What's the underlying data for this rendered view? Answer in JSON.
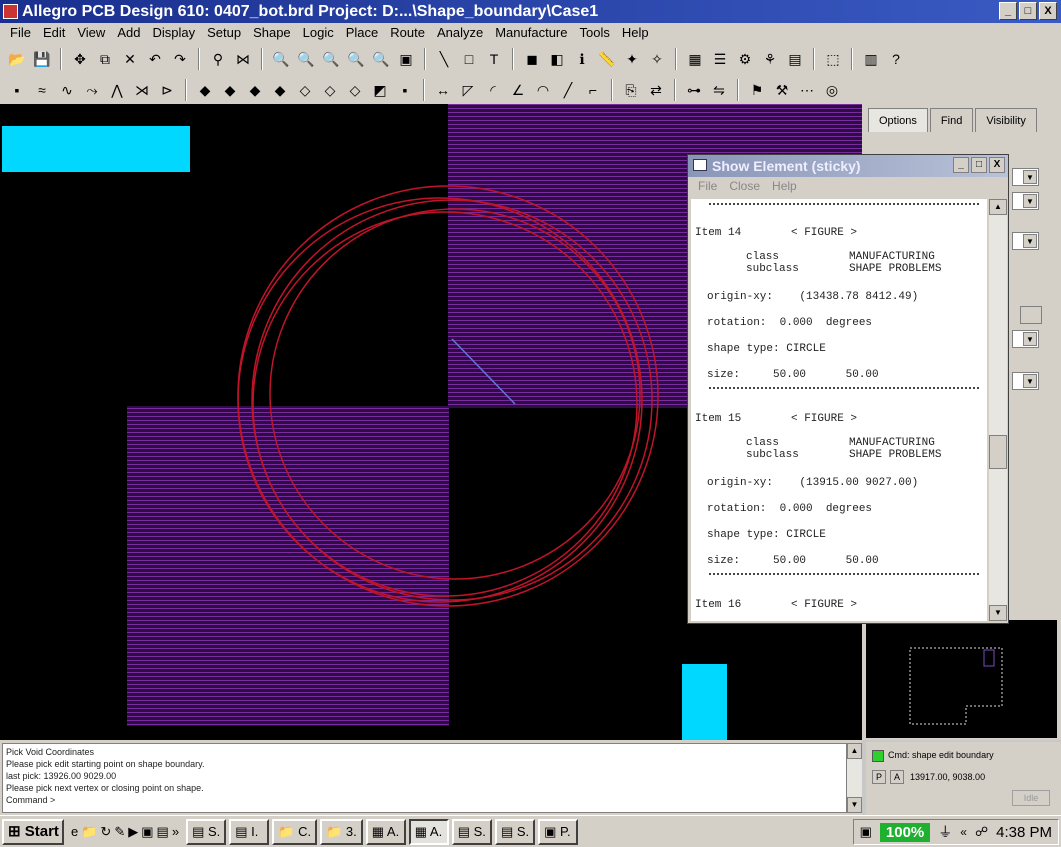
{
  "window": {
    "title": "Allegro PCB Design 610: 0407_bot.brd  Project: D:...\\Shape_boundary\\Case1",
    "controls": [
      "_",
      "□",
      "X"
    ]
  },
  "menubar": [
    "File",
    "Edit",
    "View",
    "Add",
    "Display",
    "Setup",
    "Shape",
    "Logic",
    "Place",
    "Route",
    "Analyze",
    "Manufacture",
    "Tools",
    "Help"
  ],
  "toolbar": {
    "row1": [
      "open-icon",
      "save-icon",
      "|",
      "move-icon",
      "copy-icon",
      "delete-icon",
      "undo-icon",
      "redo-icon",
      "|",
      "pin-icon",
      "ratsnest-icon",
      "|",
      "zoom-points-icon",
      "zoom-in-icon",
      "zoom-out-icon",
      "zoom-fit-icon",
      "zoom-prev-icon",
      "3d-view-icon",
      "|",
      "add-line-icon",
      "add-rect-icon",
      "add-text-icon",
      "|",
      "color-icon",
      "shadow-icon",
      "info-icon",
      "measure-icon",
      "highlight-icon",
      "dehighlight-icon",
      "|",
      "grid-icon",
      "layers-icon",
      "constraint-icon",
      "spif-icon",
      "cmgr-icon",
      "|",
      "place-icon",
      "|",
      "report-icon",
      "help-icon"
    ],
    "row2": [
      "add-connect-icon",
      "slide-icon",
      "delay-tune-icon",
      "custom-smooth-icon",
      "vertex-icon",
      "spread-icon",
      "fanout-icon",
      "|",
      "shape-add-icon",
      "shape-rect-icon",
      "shape-circle-icon",
      "shape-select-icon",
      "void-poly-icon",
      "void-rect-icon",
      "void-circle-icon",
      "edit-boundary-icon",
      "manual-void-icon",
      "|",
      "dimension-icon",
      "chamfer-icon",
      "fillet-icon",
      "angle-icon",
      "arc-icon",
      "line-icon",
      "segment-icon",
      "|",
      "sub-drawing-icon",
      "swap-icon",
      "|",
      "net-logic-icon",
      "pin-swap-icon",
      "|",
      "assign-icon",
      "tool-icon",
      "bus-icon",
      "spectra-icon"
    ]
  },
  "options_panel": {
    "tabs": [
      "Options",
      "Find",
      "Visibility"
    ]
  },
  "show_element": {
    "title": "Show Element (sticky)",
    "menu": [
      "File",
      "Close",
      "Help"
    ],
    "items": [
      {
        "header": "Item 14",
        "type": "< FIGURE >",
        "class_label": "class",
        "class_value": "MANUFACTURING",
        "subclass_label": "subclass",
        "subclass_value": "SHAPE PROBLEMS",
        "origin": "origin-xy:    (13438.78 8412.49)",
        "rotation": "rotation:  0.000  degrees",
        "shape": "shape type: CIRCLE",
        "size": "size:     50.00      50.00"
      },
      {
        "header": "Item 15",
        "type": "< FIGURE >",
        "class_label": "class",
        "class_value": "MANUFACTURING",
        "subclass_label": "subclass",
        "subclass_value": "SHAPE PROBLEMS",
        "origin": "origin-xy:    (13915.00 9027.00)",
        "rotation": "rotation:  0.000  degrees",
        "shape": "shape type: CIRCLE",
        "size": "size:     50.00      50.00"
      },
      {
        "header": "Item 16",
        "type": "< FIGURE >"
      }
    ]
  },
  "command_window": {
    "lines": [
      "Pick Void Coordinates",
      "Please pick edit starting point on shape boundary.",
      "last pick:  13926.00 9029.00",
      "Please pick next vertex or closing point on shape.",
      "Command >"
    ]
  },
  "status": {
    "cmd": "Cmd:  shape edit boundary",
    "p_label": "P",
    "a_label": "A",
    "coords": "13917.00, 9038.00",
    "idle": "Idle"
  },
  "taskbar": {
    "start": "Start",
    "quick_icons": [
      "ie-icon",
      "folder-icon",
      "refresh-icon",
      "pen-icon",
      "media-icon",
      "app-icon",
      "app2-icon",
      "chevron-icon"
    ],
    "tasks": [
      {
        "label": "S.",
        "icon": "doc-icon",
        "active": false
      },
      {
        "label": "I.",
        "icon": "doc-icon",
        "active": false
      },
      {
        "label": "C.",
        "icon": "folder-icon",
        "active": false
      },
      {
        "label": "3.",
        "icon": "folder-icon",
        "active": false
      },
      {
        "label": "A.",
        "icon": "allegro-icon",
        "active": false
      },
      {
        "label": "A.",
        "icon": "allegro-icon",
        "active": true
      },
      {
        "label": "S.",
        "icon": "doc-icon",
        "active": false
      },
      {
        "label": "S.",
        "icon": "doc-icon",
        "active": false
      },
      {
        "label": "P.",
        "icon": "app-icon",
        "active": false
      }
    ],
    "battery": "100%",
    "clock": "4:38 PM"
  },
  "colors": {
    "canvas_bg": "#000000",
    "shape_fill": "#3a1450",
    "shape_hatch": "#7a2aa0",
    "drc_circle": "#c0142a",
    "rect_cyan": "#00d8ff"
  }
}
